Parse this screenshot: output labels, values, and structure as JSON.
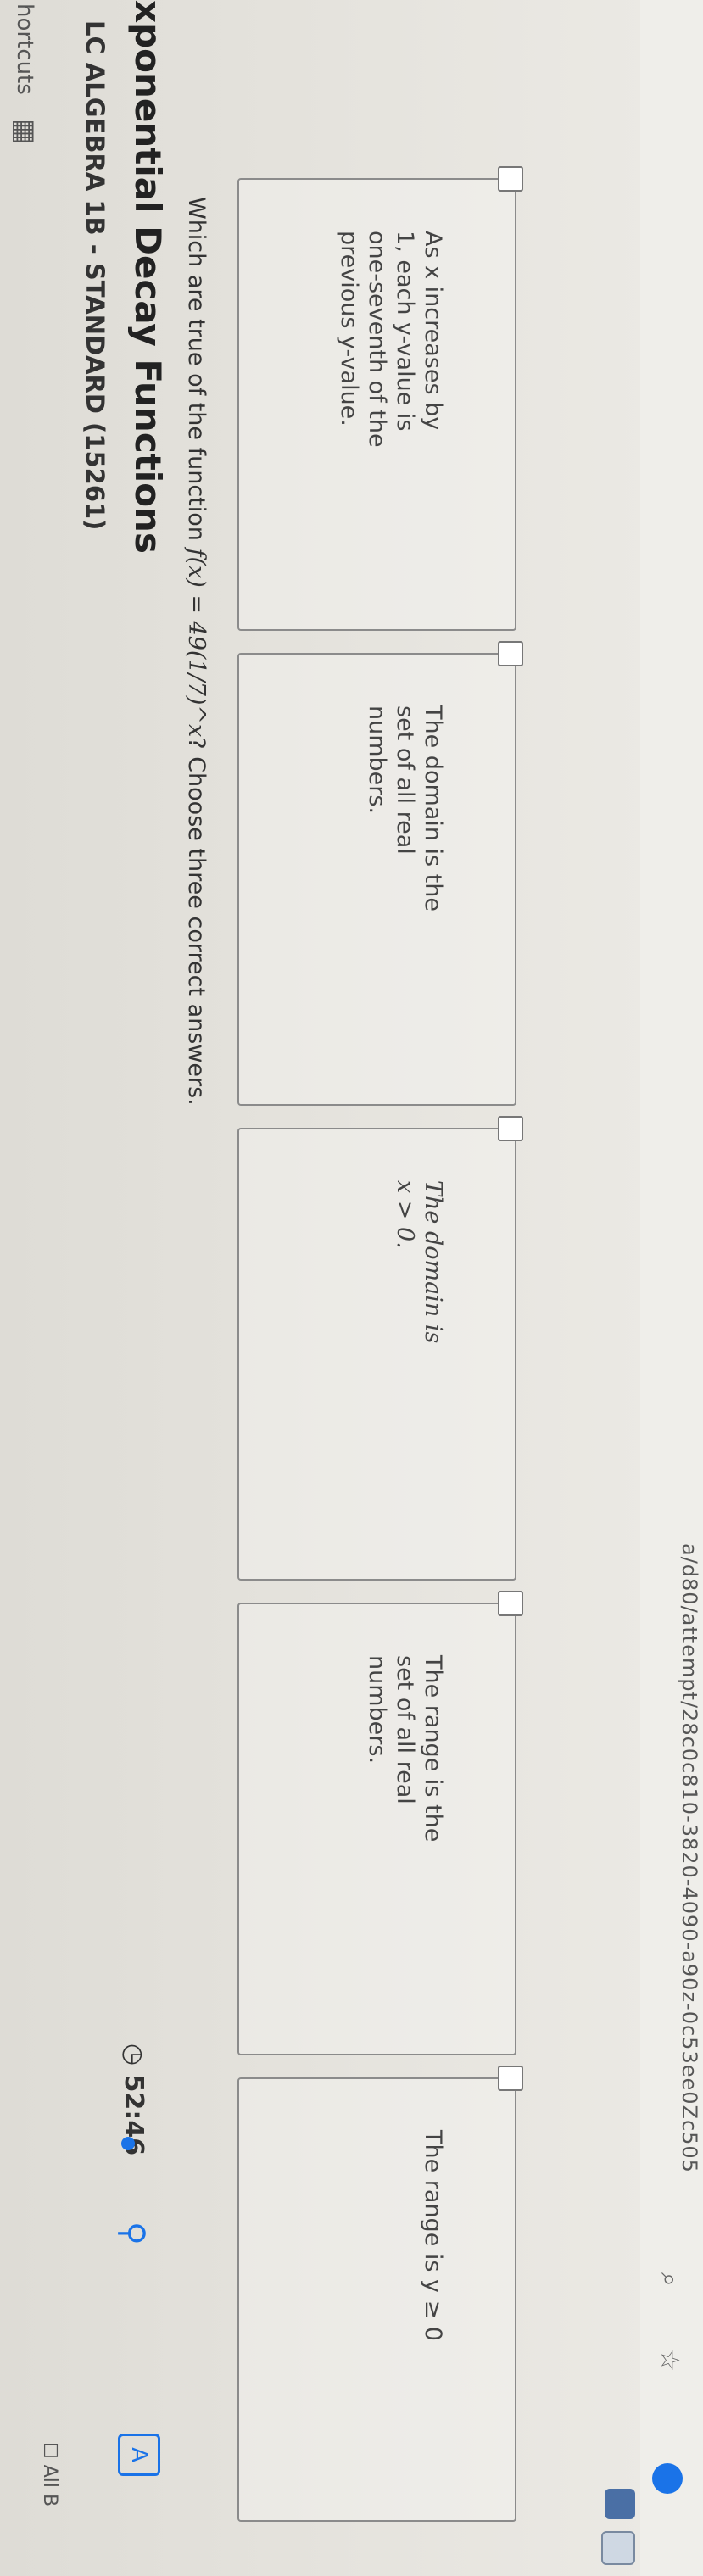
{
  "browser": {
    "url": "a/d80/attempt/28c0c810-3820-4090-a90z-0c53ee0Zc505",
    "all_bookmarks": "All B",
    "shortcuts_label": "hortcuts"
  },
  "header": {
    "course": "LC ALGEBRA 1B - STANDARD (15261)",
    "lesson": "xponential Decay Functions",
    "timer": "52:46"
  },
  "question": {
    "prefix": "Which are true of the function ",
    "function": "f(x) = 49(1/7)^x",
    "suffix": "? Choose three correct answers."
  },
  "choices": [
    {
      "text": "As x increases by\n1, each y-value is\none-seventh of the\nprevious y-value."
    },
    {
      "text": "The domain is the\nset of all real\nnumbers."
    },
    {
      "text": "The domain is\nx > 0."
    },
    {
      "text": "The range is the\nset of all real\nnumbers."
    },
    {
      "text": "The range is y ≥ 0"
    }
  ],
  "icons": [
    "search-icon",
    "star-icon",
    "all-bookmarks-icon",
    "apps-grid-icon",
    "timer-icon",
    "hint-icon",
    "text-to-speech-icon",
    "extension-icon"
  ]
}
